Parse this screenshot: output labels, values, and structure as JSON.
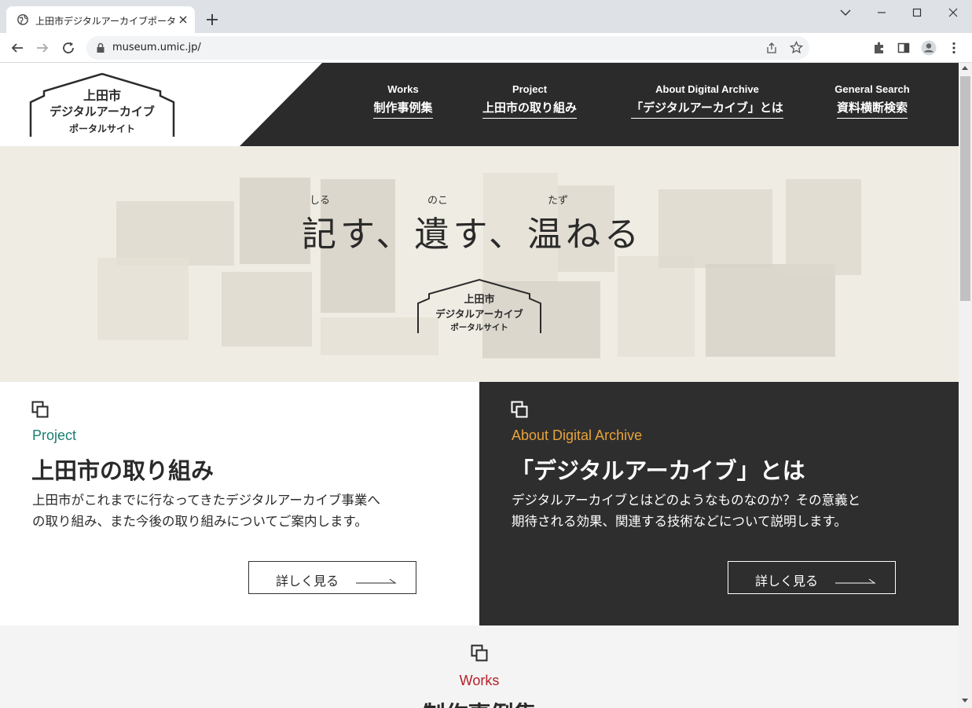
{
  "browser": {
    "tab_title": "上田市デジタルアーカイブポータルサイト",
    "url": "museum.umic.jp/"
  },
  "site": {
    "logo_lines": [
      "上田市",
      "デジタルアーカイブ",
      "ポータルサイト"
    ],
    "nav": [
      {
        "en": "Works",
        "ja": "制作事例集"
      },
      {
        "en": "Project",
        "ja": "上田市の取り組み"
      },
      {
        "en": "About Digital Archive",
        "ja": "「デジタルアーカイブ」とは"
      },
      {
        "en": "General Search",
        "ja": "資料横断検索"
      }
    ]
  },
  "hero": {
    "ruby": [
      "しる",
      "のこ",
      "たず"
    ],
    "title": "記す、遺す、温ねる",
    "logo_lines": [
      "上田市",
      "デジタルアーカイブ",
      "ポータルサイト"
    ]
  },
  "cards": [
    {
      "label": "Project",
      "title": "上田市の取り組み",
      "desc_lines": [
        "上田市がこれまでに行なってきたデジタルアーカイブ事業へ",
        "の取り組み、また今後の取り組みについてご案内します。"
      ],
      "more": "詳しく見る"
    },
    {
      "label": "About Digital Archive",
      "title": "「デジタルアーカイブ」とは",
      "desc_lines": [
        "デジタルアーカイブとはどのようなものなのか？その意義と",
        "期待される効果、関連する技術などについて説明します。"
      ],
      "more": "詳しく見る"
    }
  ],
  "works": {
    "label": "Works",
    "title": "制作事例集"
  },
  "colors": {
    "header_dark": "#2b2b2b",
    "project_label": "#1b7e74",
    "about_label": "#e8a33a",
    "works_label": "#b5202a"
  }
}
